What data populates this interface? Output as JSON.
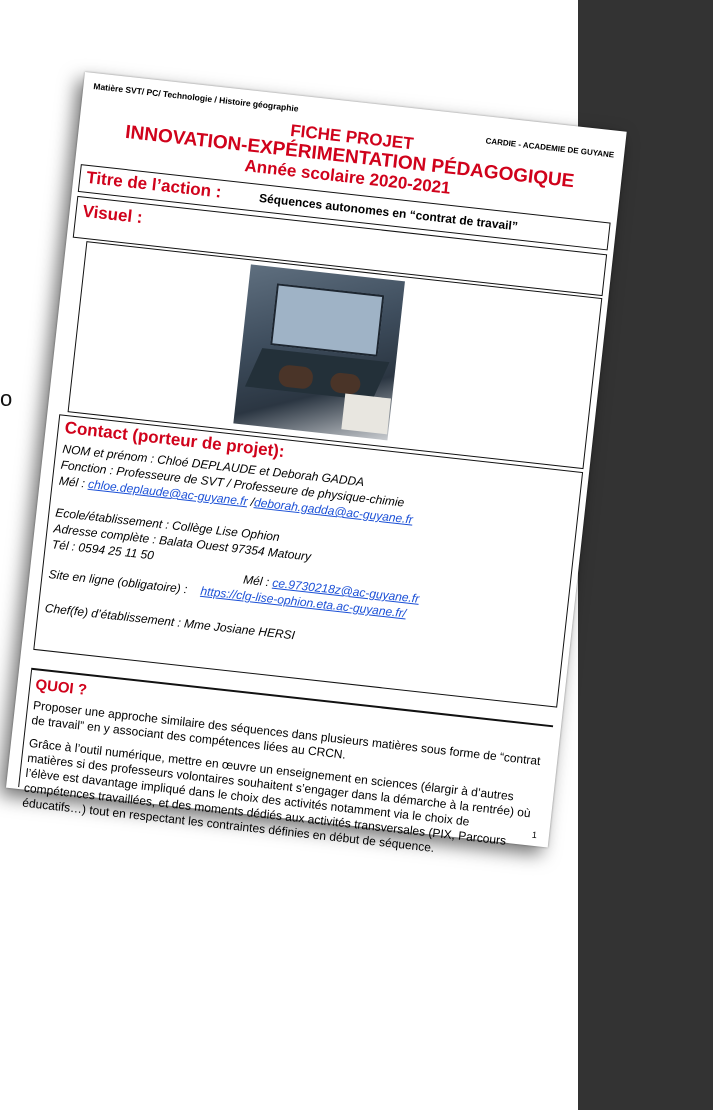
{
  "edge_glyph": "o",
  "header": {
    "subjects": "Matière SVT/ PC/ Technologie / Histoire géographie",
    "academy": "CARDIE - ACADEMIE DE GUYANE"
  },
  "titles": {
    "line1": "FICHE PROJET",
    "line2": "INNOVATION-EXPÉRIMENTATION PÉDAGOGIQUE",
    "line3": "Année scolaire 2020-2021"
  },
  "action": {
    "label": "Titre de l’action :",
    "text": "Séquences autonomes en “contrat de travail”"
  },
  "visuel": {
    "label": "Visuel :"
  },
  "contact": {
    "title": "Contact (porteur de projet):",
    "nom": "NOM et prénom : Chloé DEPLAUDE et Deborah GADDA",
    "fonction": "Fonction : Professeure de SVT / Professeure de physique-chimie",
    "mel_label": "Mél : ",
    "mel1": "chloe.deplaude@ac-guyane.fr",
    "mel_sep": " /",
    "mel2": "deborah.gadda@ac-guyane.fr",
    "ecole": "Ecole/établissement : Collège Lise Ophion",
    "adresse": "Adresse complète : Balata Ouest 97354 Matoury",
    "tel": "Tél : 0594 25 11 50",
    "mel_etab_label": "Mél : ",
    "mel_etab": "ce.9730218z@ac-guyane.fr",
    "site_label": "Site en ligne (obligatoire) :",
    "site": "https://clg-lise-ophion.eta.ac-guyane.fr/",
    "chef": "Chef(fe) d’établissement : Mme Josiane HERSI"
  },
  "quoi": {
    "title": "QUOI ?",
    "p1": "Proposer une approche similaire des séquences dans plusieurs matières sous forme de “contrat de travail” en y associant des compétences liées au CRCN.",
    "p2": "Grâce à l’outil numérique, mettre en œuvre un enseignement en sciences (élargir à d’autres matières si des professeurs volontaires souhaitent s’engager dans la démarche à la rentrée) où l’élève est davantage impliqué dans le choix des activités notamment via le choix de compétences travaillées, et des moments dédiés aux activités transversales (PIX, Parcours éducatifs…) tout en respectant les contraintes définies en début de séquence."
  },
  "page_number": "1"
}
